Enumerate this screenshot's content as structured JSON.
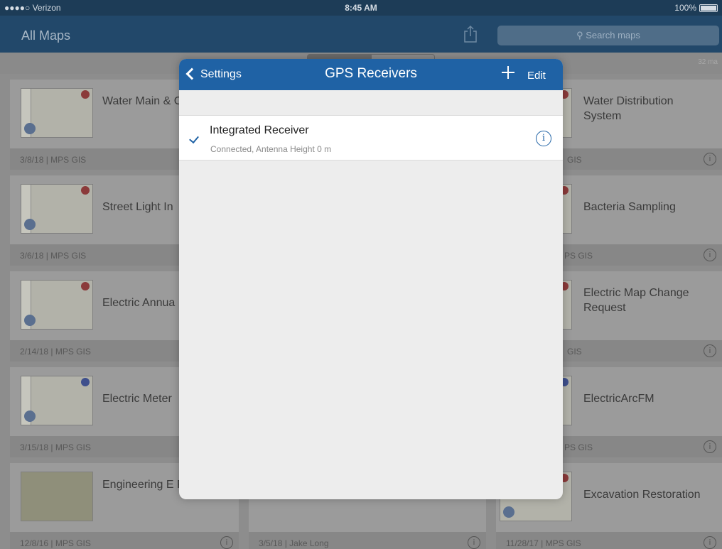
{
  "status_bar": {
    "carrier": "●●●●○ Verizon",
    "time": "8:45 AM",
    "battery": "100%"
  },
  "nav": {
    "title": "All Maps",
    "search_placeholder": "Search maps"
  },
  "count_label": "32 ma",
  "left_cards": [
    {
      "name": "Water Main & Cards",
      "footer": "3/8/18 | MPS GIS",
      "badge": "red"
    },
    {
      "name": "Street Light In",
      "footer": "3/6/18 | MPS GIS",
      "badge": "red"
    },
    {
      "name": "Electric Annua",
      "footer": "2/14/18 | MPS GIS",
      "badge": "red"
    },
    {
      "name": "Electric Meter",
      "footer": "3/15/18 | MPS GIS",
      "badge": "blue"
    },
    {
      "name": "Engineering E Permits",
      "footer": "12/8/16 | MPS GIS",
      "badge": "none"
    }
  ],
  "right_cards": [
    {
      "name": "Water Distribution System",
      "footer": "GIS"
    },
    {
      "name": "Bacteria Sampling",
      "footer": "PS GIS"
    },
    {
      "name": "Electric Map Change Request",
      "footer": "GIS"
    },
    {
      "name": "ElectricArcFM",
      "footer": "PS GIS"
    },
    {
      "name": "Excavation Restoration",
      "footer": "11/28/17 | MPS GIS"
    }
  ],
  "mid_card": {
    "footer": "3/5/18 | Jake Long"
  },
  "info_glyph": "i",
  "modal": {
    "back_label": "Settings",
    "title": "GPS Receivers",
    "edit_label": "Edit",
    "receiver": {
      "name": "Integrated Receiver",
      "details": "Connected, Antenna Height 0 m",
      "selected": true
    }
  },
  "colors": {
    "header_blue": "#1f62a5",
    "nav_dark": "#22486a"
  }
}
